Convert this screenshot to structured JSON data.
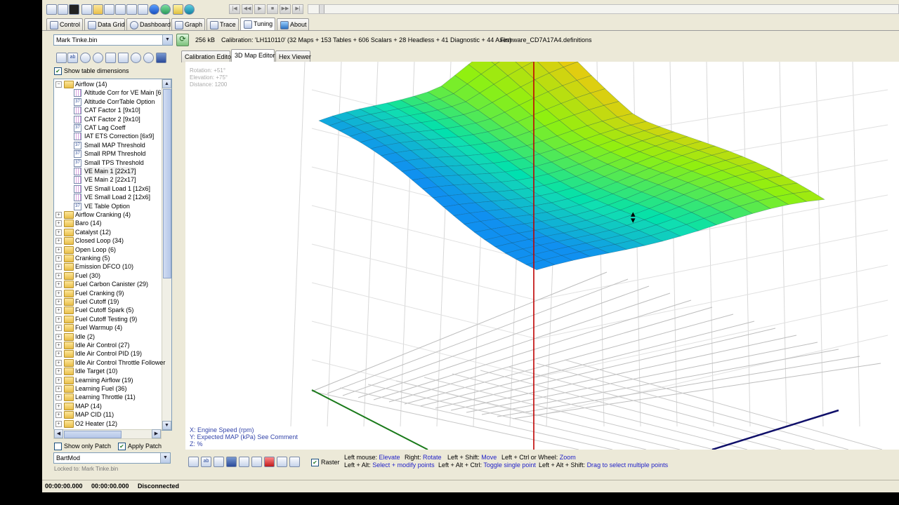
{
  "tabs": [
    {
      "label": "Control"
    },
    {
      "label": "Data Grid"
    },
    {
      "label": "Dashboard"
    },
    {
      "label": "Graph"
    },
    {
      "label": "Trace"
    },
    {
      "label": "Tuning"
    },
    {
      "label": "About"
    }
  ],
  "file_combo": {
    "value": "Mark Tinke.bin"
  },
  "info_bar": {
    "size": "256 kB",
    "calibration": "Calibration: 'LH110110'",
    "counts": "(32 Maps + 153 Tables + 606 Scalars + 28 Headless + 41 Diagnostic + 44 Axes)",
    "definition": "Firmware_CD7A17A4.definitions"
  },
  "sub_tabs": [
    {
      "label": "Calibration Editor"
    },
    {
      "label": "3D Map Editor"
    },
    {
      "label": "Hex Viewer"
    }
  ],
  "show_dims": {
    "label": "Show table dimensions"
  },
  "tree": {
    "root": "Airflow  (14)",
    "children": [
      "Altitude Corr for VE Main  [6",
      "Altitude CorrTable Option",
      "CAT Factor 1  [9x10]",
      "CAT Factor 2  [9x10]",
      "CAT Lag Coeff",
      "IAT ETS Correction  [6x9]",
      "Small MAP Threshold",
      "Small RPM Threshold",
      "Small TPS Threshold",
      "VE Main 1  [22x17]",
      "VE Main 2  [22x17]",
      "VE Small Load 1  [12x6]",
      "VE Small Load 2  [12x6]",
      "VE Table Option"
    ],
    "folders": [
      "Airflow Cranking  (4)",
      "Baro  (14)",
      "Catalyst  (12)",
      "Closed Loop  (34)",
      "Open Loop  (6)",
      "Cranking  (5)",
      "Emission DFCO  (10)",
      "Fuel  (30)",
      "Fuel Carbon Canister  (29)",
      "Fuel Cranking  (9)",
      "Fuel Cutoff  (19)",
      "Fuel Cutoff Spark  (5)",
      "Fuel Cutoff Testing  (9)",
      "Fuel Warmup  (4)",
      "Idle  (2)",
      "Idle Air Control  (27)",
      "Idle Air Control PID  (19)",
      "Idle Air Control Throttle Follower",
      "Idle Target  (10)",
      "Learning Airflow  (19)",
      "Learning Fuel  (36)",
      "Learning Throttle  (11)",
      "MAP  (14)",
      "MAP CID  (11)",
      "O2 Heater  (12)"
    ]
  },
  "patch": {
    "show_only": "Show only Patch",
    "apply": "Apply Patch",
    "combo": "BartMod",
    "locked": "Locked to: Mark Tinke.bin"
  },
  "overlay": {
    "rotation": "Rotation:  +51°",
    "elevation": "Elevation:  +75°",
    "distance": "Distance:  1200"
  },
  "axes": {
    "x": "X: Engine Speed (rpm)",
    "y": "Y: Expected MAP (kPa) See Comment",
    "z": "Z: %"
  },
  "raster": {
    "label": "Raster"
  },
  "hints": {
    "l1a": "Left mouse:",
    "l1b": "Elevate",
    "r1a": "Right:",
    "r1b": "Rotate",
    "s1a": "Left + Shift:",
    "s1b": "Move",
    "c1a": "Left + Ctrl or Wheel:",
    "c1b": "Zoom",
    "l2a": "Left + Alt:",
    "l2b": "Select + modify points",
    "c2a": "Left + Alt + Ctrl:",
    "c2b": "Toggle single point",
    "s2a": "Left + Alt + Shift:",
    "s2b": "Drag to select multiple points"
  },
  "status": {
    "t1": "00:00:00.000",
    "t2": "00:00:00.000",
    "conn": "Disconnected"
  },
  "colors": {
    "surface_high": "#ffd400",
    "surface_mid": "#7cf000",
    "surface_low": "#20a0f0",
    "axis_x": "#1a7a1a",
    "axis_y": "#10106a",
    "axis_z": "#c00000"
  }
}
